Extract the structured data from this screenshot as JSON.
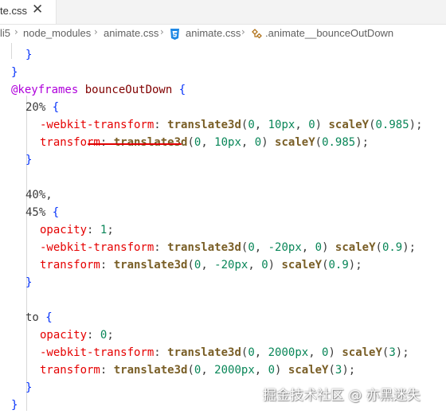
{
  "tab": {
    "title": "te.css",
    "close": "✕"
  },
  "breadcrumb": {
    "items": [
      "li5",
      "node_modules",
      "animate.css",
      "animate.css",
      ".animate__bounceOutDown"
    ],
    "separator": "›"
  },
  "code": {
    "lines": [
      {
        "indent": 1,
        "tokens": [
          [
            "}",
            "brace"
          ]
        ]
      },
      {
        "indent": 0,
        "tokens": [
          [
            "}",
            "brace"
          ]
        ]
      },
      {
        "indent": 0,
        "tokens": [
          [
            "@keyframes ",
            "at"
          ],
          [
            "bounceOutDown",
            "sel"
          ],
          [
            " ",
            "txt"
          ],
          [
            "{",
            "brace"
          ]
        ]
      },
      {
        "indent": 1,
        "tokens": [
          [
            "20% ",
            "txt"
          ],
          [
            "{",
            "brace"
          ]
        ]
      },
      {
        "indent": 2,
        "tokens": [
          [
            "-webkit-transform",
            "prop"
          ],
          [
            ": ",
            "txt"
          ],
          [
            "translate3d",
            "fn"
          ],
          [
            "(",
            "txt"
          ],
          [
            "0",
            "num"
          ],
          [
            ", ",
            "txt"
          ],
          [
            "10px",
            "num"
          ],
          [
            ", ",
            "txt"
          ],
          [
            "0",
            "num"
          ],
          [
            ") ",
            "txt"
          ],
          [
            "scaleY",
            "fn"
          ],
          [
            "(",
            "txt"
          ],
          [
            "0.985",
            "num"
          ],
          [
            ");",
            "txt"
          ]
        ]
      },
      {
        "indent": 2,
        "tokens": [
          [
            "transform",
            "prop"
          ],
          [
            ": ",
            "txt"
          ],
          [
            "translate3d",
            "fn"
          ],
          [
            "(",
            "txt"
          ],
          [
            "0",
            "num"
          ],
          [
            ", ",
            "txt"
          ],
          [
            "10px",
            "num"
          ],
          [
            ", ",
            "txt"
          ],
          [
            "0",
            "num"
          ],
          [
            ") ",
            "txt"
          ],
          [
            "scaleY",
            "fn"
          ],
          [
            "(",
            "txt"
          ],
          [
            "0.985",
            "num"
          ],
          [
            ");",
            "txt"
          ]
        ]
      },
      {
        "indent": 1,
        "tokens": [
          [
            "}",
            "brace"
          ]
        ]
      },
      {
        "indent": 0,
        "tokens": []
      },
      {
        "indent": 1,
        "tokens": [
          [
            "40%,",
            "txt"
          ]
        ]
      },
      {
        "indent": 1,
        "tokens": [
          [
            "45% ",
            "txt"
          ],
          [
            "{",
            "brace"
          ]
        ]
      },
      {
        "indent": 2,
        "tokens": [
          [
            "opacity",
            "prop"
          ],
          [
            ": ",
            "txt"
          ],
          [
            "1",
            "num"
          ],
          [
            ";",
            "txt"
          ]
        ]
      },
      {
        "indent": 2,
        "tokens": [
          [
            "-webkit-transform",
            "prop"
          ],
          [
            ": ",
            "txt"
          ],
          [
            "translate3d",
            "fn"
          ],
          [
            "(",
            "txt"
          ],
          [
            "0",
            "num"
          ],
          [
            ", ",
            "txt"
          ],
          [
            "-20px",
            "num"
          ],
          [
            ", ",
            "txt"
          ],
          [
            "0",
            "num"
          ],
          [
            ") ",
            "txt"
          ],
          [
            "scaleY",
            "fn"
          ],
          [
            "(",
            "txt"
          ],
          [
            "0.9",
            "num"
          ],
          [
            ");",
            "txt"
          ]
        ]
      },
      {
        "indent": 2,
        "tokens": [
          [
            "transform",
            "prop"
          ],
          [
            ": ",
            "txt"
          ],
          [
            "translate3d",
            "fn"
          ],
          [
            "(",
            "txt"
          ],
          [
            "0",
            "num"
          ],
          [
            ", ",
            "txt"
          ],
          [
            "-20px",
            "num"
          ],
          [
            ", ",
            "txt"
          ],
          [
            "0",
            "num"
          ],
          [
            ") ",
            "txt"
          ],
          [
            "scaleY",
            "fn"
          ],
          [
            "(",
            "txt"
          ],
          [
            "0.9",
            "num"
          ],
          [
            ");",
            "txt"
          ]
        ]
      },
      {
        "indent": 1,
        "tokens": [
          [
            "}",
            "brace"
          ]
        ]
      },
      {
        "indent": 0,
        "tokens": []
      },
      {
        "indent": 1,
        "tokens": [
          [
            "to ",
            "txt"
          ],
          [
            "{",
            "brace"
          ]
        ]
      },
      {
        "indent": 2,
        "tokens": [
          [
            "opacity",
            "prop"
          ],
          [
            ": ",
            "txt"
          ],
          [
            "0",
            "num"
          ],
          [
            ";",
            "txt"
          ]
        ]
      },
      {
        "indent": 2,
        "tokens": [
          [
            "-webkit-transform",
            "prop"
          ],
          [
            ": ",
            "txt"
          ],
          [
            "translate3d",
            "fn"
          ],
          [
            "(",
            "txt"
          ],
          [
            "0",
            "num"
          ],
          [
            ", ",
            "txt"
          ],
          [
            "2000px",
            "num"
          ],
          [
            ", ",
            "txt"
          ],
          [
            "0",
            "num"
          ],
          [
            ") ",
            "txt"
          ],
          [
            "scaleY",
            "fn"
          ],
          [
            "(",
            "txt"
          ],
          [
            "3",
            "num"
          ],
          [
            ");",
            "txt"
          ]
        ]
      },
      {
        "indent": 2,
        "tokens": [
          [
            "transform",
            "prop"
          ],
          [
            ": ",
            "txt"
          ],
          [
            "translate3d",
            "fn"
          ],
          [
            "(",
            "txt"
          ],
          [
            "0",
            "num"
          ],
          [
            ", ",
            "txt"
          ],
          [
            "2000px",
            "num"
          ],
          [
            ", ",
            "txt"
          ],
          [
            "0",
            "num"
          ],
          [
            ") ",
            "txt"
          ],
          [
            "scaleY",
            "fn"
          ],
          [
            "(",
            "txt"
          ],
          [
            "3",
            "num"
          ],
          [
            ");",
            "txt"
          ]
        ]
      },
      {
        "indent": 1,
        "tokens": [
          [
            "}",
            "brace"
          ]
        ]
      },
      {
        "indent": 0,
        "tokens": [
          [
            "}",
            "brace"
          ]
        ]
      }
    ]
  },
  "watermark": "掘金技术社区 @ 亦黑迷失",
  "colors": {
    "keyword": "#af00db",
    "selector": "#800000",
    "property": "#e50000",
    "function": "#795e26",
    "number": "#098658",
    "brace": "#0431fa",
    "underline": "#e00000"
  },
  "icons": [
    "close-icon",
    "chevron-right-icon",
    "css3-file-icon",
    "symbol-class-icon"
  ]
}
